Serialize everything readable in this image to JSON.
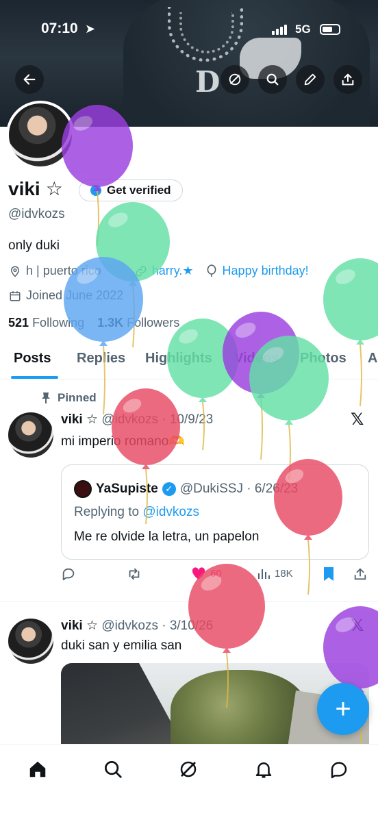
{
  "status_bar": {
    "time": "07:10",
    "network": "5G"
  },
  "header_buttons": {
    "back": "back-arrow-icon",
    "grok": "grok-icon",
    "search": "search-icon",
    "edit": "pencil-icon",
    "share": "share-icon"
  },
  "profile": {
    "name": "viki",
    "star": "☆",
    "get_verified": "Get verified",
    "handle": "@idvkozs",
    "bio": "only duki",
    "location": "h | puerto rico",
    "link": "harry.★",
    "birthday": "Happy birthday!",
    "joined": "Joined June 2022",
    "following_count": "521",
    "following_label": "Following",
    "followers_count": "1.3K",
    "followers_label": "Followers"
  },
  "tabs": [
    "Posts",
    "Replies",
    "Highlights",
    "Videos",
    "Photos",
    "A"
  ],
  "posts": [
    {
      "pinned_label": "Pinned",
      "name": "viki",
      "star": "☆",
      "handle_date": "@idvkozs · 10/9/23",
      "text": "mi imperio romano🫶",
      "quote": {
        "name": "YaSupiste",
        "handle_date": "@DukiSSJ · 6/26/23",
        "replying_prefix": "Replying to",
        "replying_handle": "@idvkozs",
        "text": "Me re olvide la letra, un papelon"
      },
      "actions": {
        "likes": "60",
        "views": "18K"
      }
    },
    {
      "name": "viki",
      "star": "☆",
      "handle_date": "@idvkozs · 3/10/26",
      "text": "duki san y emilia san"
    }
  ],
  "fab_label": "+",
  "bottom_nav": [
    "home-icon",
    "search-icon",
    "grok-icon",
    "notifications-icon",
    "messages-icon"
  ],
  "colors": {
    "accent": "#1d9bf0",
    "text": "#0f1419",
    "secondary": "#536471",
    "balloon_purple": "#9b3fe0",
    "balloon_green": "#63e0a6",
    "balloon_blue": "#5ea5f2",
    "balloon_red": "#e84a63"
  }
}
